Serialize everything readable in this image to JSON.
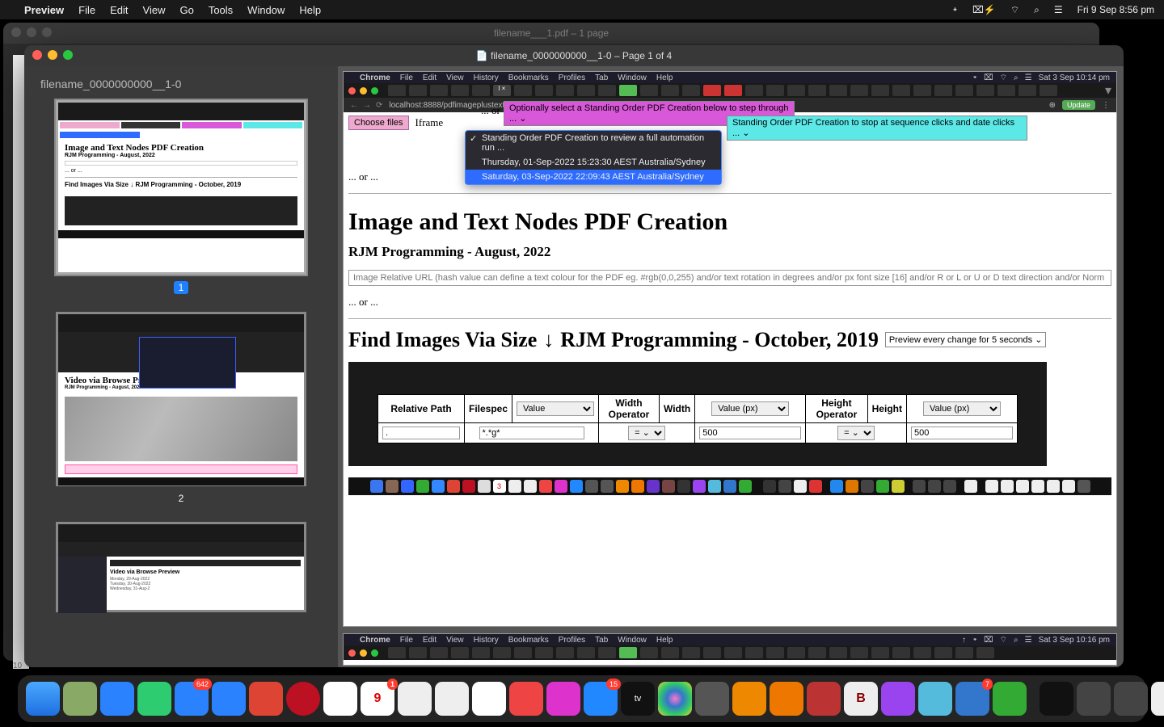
{
  "menubar": {
    "app": "Preview",
    "items": [
      "File",
      "Edit",
      "View",
      "Go",
      "Tools",
      "Window",
      "Help"
    ],
    "clock": "Fri 9 Sep  8:56 pm"
  },
  "bg_window": {
    "title": "filename___1.pdf – 1 page"
  },
  "fg_window": {
    "title": "filename_0000000000__1-0 – Page 1 of 4",
    "sidebar_title": "filename_0000000000__1-0",
    "page_nums": [
      "1",
      "2"
    ]
  },
  "inner_chrome": {
    "menus": [
      "Chrome",
      "File",
      "Edit",
      "View",
      "History",
      "Bookmarks",
      "Profiles",
      "Tab",
      "Window",
      "Help"
    ],
    "clock": "Sat 3 Sep  10:14 pm",
    "url": "localhost:8888/pdfimageplustext.php?mytzn=Australia%2FSydney",
    "update": "Update"
  },
  "controls": {
    "choose_files": "Choose files",
    "iframe": "Iframe",
    "or": "... or ...",
    "opt_label": "Optionally select a Standing Order PDF Creation below to step through ... ⌄",
    "stop_label": "Standing Order PDF Creation to stop at sequence clicks and date clicks ... ⌄",
    "dropdown": {
      "opt1": "Standing Order PDF Creation to review a full automation run ...",
      "opt2": "Thursday, 01-Sep-2022 15:23:30 AEST Australia/Sydney",
      "opt3": "Saturday, 03-Sep-2022 22:09:43 AEST Australia/Sydney"
    }
  },
  "headings": {
    "h1": "Image and Text Nodes PDF Creation",
    "h2": "RJM Programming - August, 2022",
    "find_a": "Find Images Via Size",
    "find_b": "RJM Programming - October, 2019",
    "preview_sel": "Preview every change for 5 seconds"
  },
  "long_input_placeholder": "Image Relative URL (hash value can define a text colour for the PDF eg. #rgb(0,0,255) and/or text rotation in degrees and/or px font size [16] and/or R or L or U or D text direction and/or Norm",
  "table": {
    "headers": [
      "Relative Path",
      "Filespec",
      "Value",
      "Width Operator",
      "Width",
      "Value (px)",
      "Height Operator",
      "Height",
      "Value (px)"
    ],
    "row": {
      "path": ".",
      "filespec": "*.*g*",
      "wop": "=  ⌄",
      "wval": "500",
      "hop": "=  ⌄",
      "hval": "500"
    }
  },
  "inner_chrome2": {
    "clock": "Sat 3 Sep  10:16 pm"
  },
  "tiny_page": "10",
  "thumb1": {
    "h1": "Image and Text Nodes PDF Creation",
    "sub": "RJM Programming - August, 2022",
    "find": "Find Images Via Size ↓ RJM Programming - October, 2019"
  },
  "thumb2": {
    "h1": "Video via Browse Preview",
    "sub": "RJM Programming - August, 2022"
  },
  "thumb3": {
    "h1": "Video via Browse Preview"
  }
}
